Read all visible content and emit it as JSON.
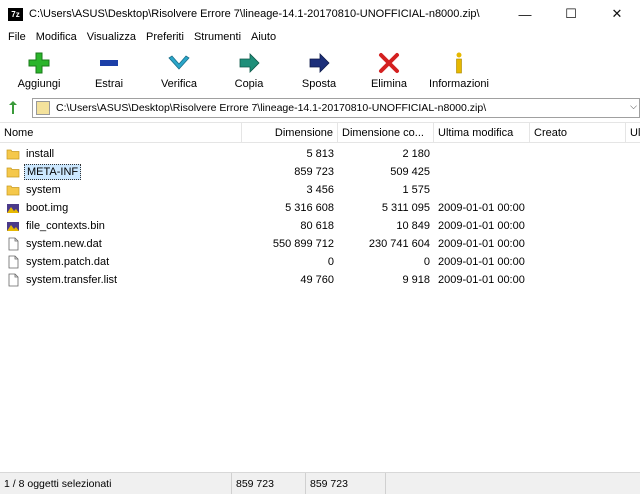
{
  "window": {
    "app_icon_label": "7z",
    "title": "C:\\Users\\ASUS\\Desktop\\Risolvere Errore 7\\lineage-14.1-20170810-UNOFFICIAL-n8000.zip\\",
    "minimize": "—",
    "maximize": "☐",
    "close": "✕"
  },
  "menu": [
    "File",
    "Modifica",
    "Visualizza",
    "Preferiti",
    "Strumenti",
    "Aiuto"
  ],
  "toolbar": [
    {
      "label": "Aggiungi",
      "icon": "add-icon",
      "color": "#2bb52b"
    },
    {
      "label": "Estrai",
      "icon": "extract-icon",
      "color": "#1c3fa8"
    },
    {
      "label": "Verifica",
      "icon": "test-icon",
      "color": "#2aa6c9"
    },
    {
      "label": "Copia",
      "icon": "copy-icon",
      "color": "#1f8f7a"
    },
    {
      "label": "Sposta",
      "icon": "move-icon",
      "color": "#1c2f7a"
    },
    {
      "label": "Elimina",
      "icon": "delete-icon",
      "color": "#d42020"
    },
    {
      "label": "Informazioni",
      "icon": "info-icon",
      "color": "#e6b800"
    }
  ],
  "address": {
    "path": "C:\\Users\\ASUS\\Desktop\\Risolvere Errore 7\\lineage-14.1-20170810-UNOFFICIAL-n8000.zip\\"
  },
  "columns": [
    "Nome",
    "Dimensione",
    "Dimensione co...",
    "Ultima modifica",
    "Creato",
    "Ul"
  ],
  "files": [
    {
      "name": "install",
      "type": "folder",
      "size": "5 813",
      "packed": "2 180",
      "modified": ""
    },
    {
      "name": "META-INF",
      "type": "folder",
      "size": "859 723",
      "packed": "509 425",
      "modified": "",
      "selected": true
    },
    {
      "name": "system",
      "type": "folder",
      "size": "3 456",
      "packed": "1 575",
      "modified": ""
    },
    {
      "name": "boot.img",
      "type": "image",
      "size": "5 316 608",
      "packed": "5 311 095",
      "modified": "2009-01-01 00:00"
    },
    {
      "name": "file_contexts.bin",
      "type": "image",
      "size": "80 618",
      "packed": "10 849",
      "modified": "2009-01-01 00:00"
    },
    {
      "name": "system.new.dat",
      "type": "file",
      "size": "550 899 712",
      "packed": "230 741 604",
      "modified": "2009-01-01 00:00"
    },
    {
      "name": "system.patch.dat",
      "type": "file",
      "size": "0",
      "packed": "0",
      "modified": "2009-01-01 00:00"
    },
    {
      "name": "system.transfer.list",
      "type": "file",
      "size": "49 760",
      "packed": "9 918",
      "modified": "2009-01-01 00:00"
    }
  ],
  "status": {
    "selection": "1 / 8 oggetti selezionati",
    "size": "859 723",
    "packed": "859 723"
  }
}
